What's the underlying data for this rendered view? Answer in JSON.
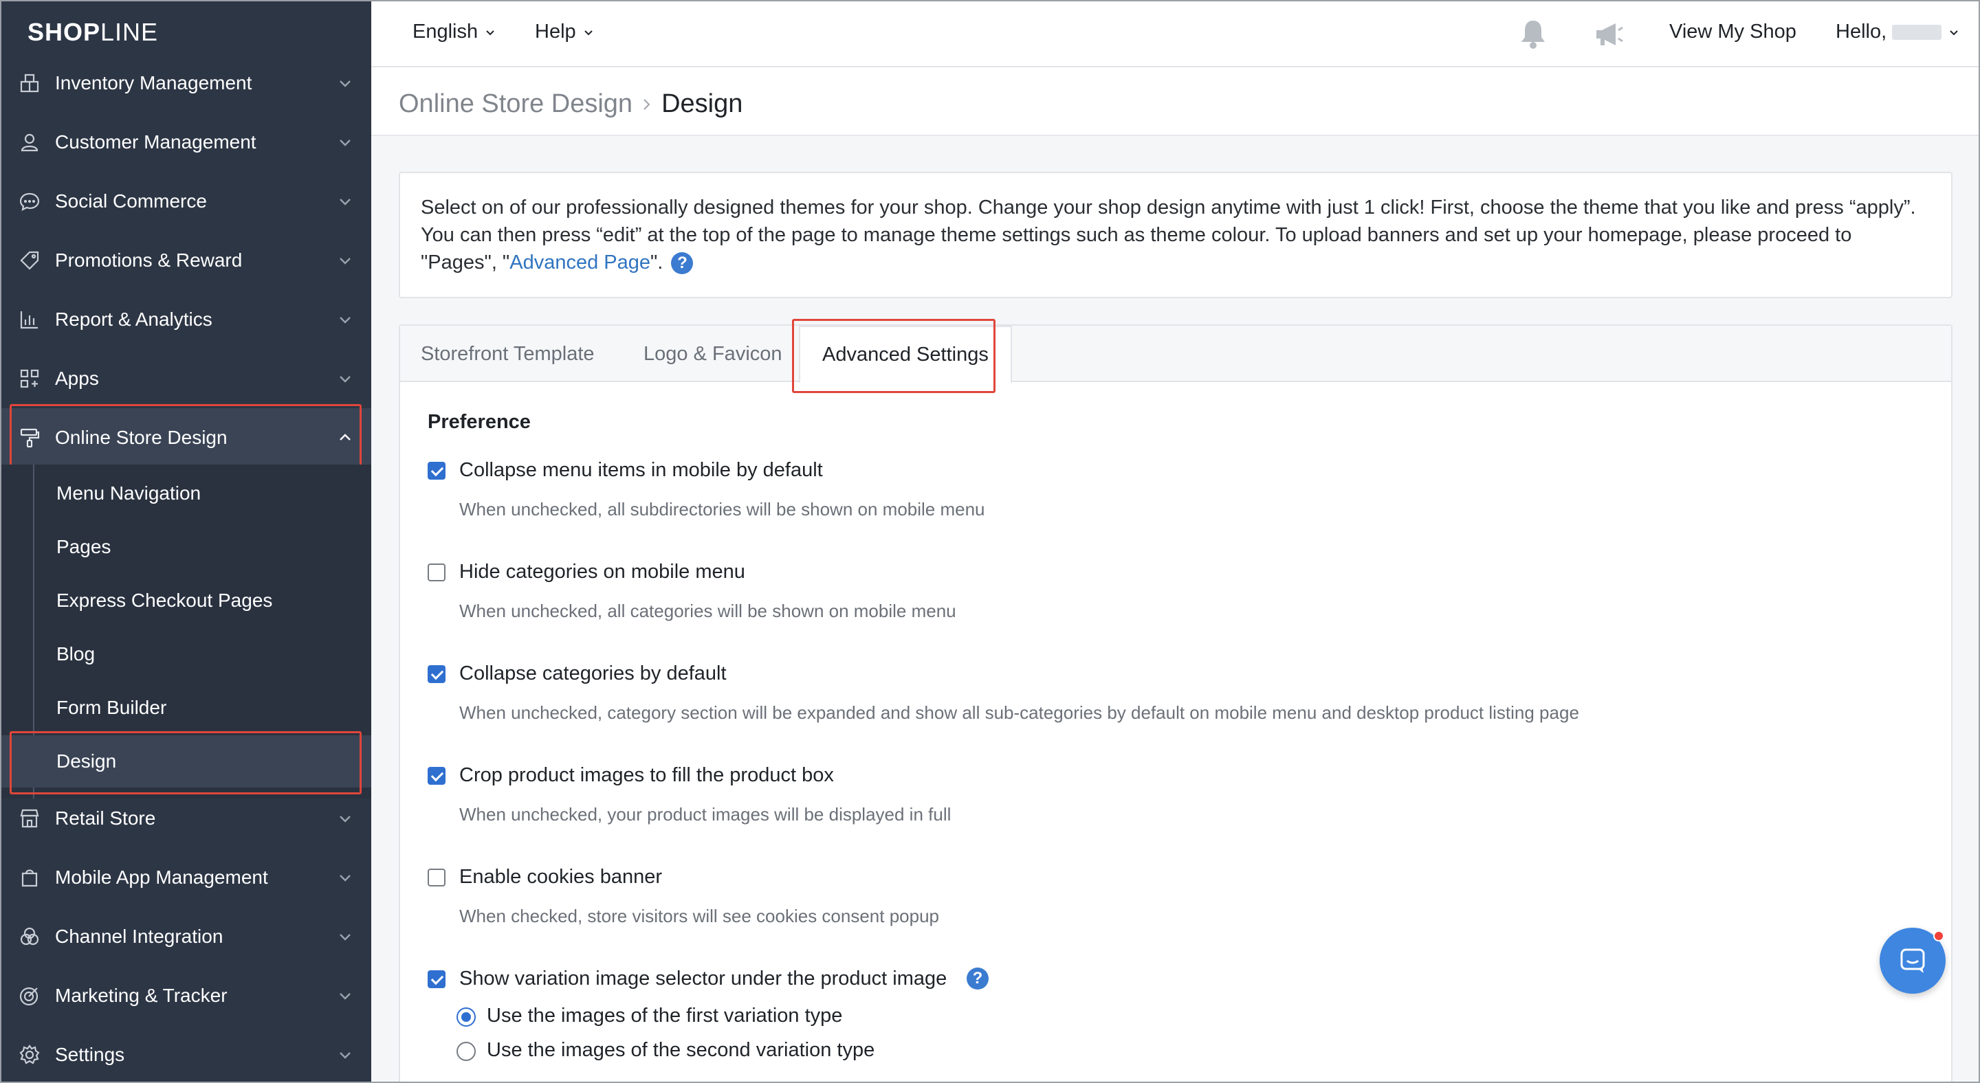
{
  "brand": {
    "logo_a": "SHOP",
    "logo_b": "LINE"
  },
  "sidebar": {
    "items": [
      {
        "label": "Inventory Management",
        "icon": "inventory-icon"
      },
      {
        "label": "Customer Management",
        "icon": "person-icon"
      },
      {
        "label": "Social Commerce",
        "icon": "chat-bubble-icon"
      },
      {
        "label": "Promotions & Reward",
        "icon": "tag-icon"
      },
      {
        "label": "Report & Analytics",
        "icon": "bar-chart-icon"
      },
      {
        "label": "Apps",
        "icon": "apps-grid-icon"
      },
      {
        "label": "Online Store Design",
        "icon": "paint-roller-icon",
        "expanded": true
      },
      {
        "label": "Retail Store",
        "icon": "store-icon"
      },
      {
        "label": "Mobile App Management",
        "icon": "shopping-bag-icon"
      },
      {
        "label": "Channel Integration",
        "icon": "channels-icon"
      },
      {
        "label": "Marketing & Tracker",
        "icon": "target-icon"
      },
      {
        "label": "Settings",
        "icon": "gear-icon"
      }
    ],
    "sub_items": [
      {
        "label": "Menu Navigation"
      },
      {
        "label": "Pages"
      },
      {
        "label": "Express Checkout Pages"
      },
      {
        "label": "Blog"
      },
      {
        "label": "Form Builder"
      },
      {
        "label": "Design",
        "active": true
      }
    ]
  },
  "topbar": {
    "language": "English",
    "help": "Help",
    "view_shop": "View My Shop",
    "greeting": "Hello,"
  },
  "breadcrumb": {
    "parent": "Online Store Design",
    "current": "Design"
  },
  "info": {
    "text_1": "Select on of our professionally designed themes for your shop. Change your shop design anytime with just 1 click! First, choose the theme that you like and press “apply”. You can then press “edit” at the top of the page to manage theme settings such as theme colour. To upload banners and set up your homepage, please proceed to \"Pages\", \"",
    "link": "Advanced Page",
    "text_2": "\"."
  },
  "tabs": [
    {
      "label": "Storefront Template"
    },
    {
      "label": "Logo & Favicon"
    },
    {
      "label": "Advanced Settings",
      "active": true
    }
  ],
  "preference": {
    "title": "Preference",
    "options": [
      {
        "label": "Collapse menu items in mobile by default",
        "desc": "When unchecked, all subdirectories will be shown on mobile menu",
        "checked": true
      },
      {
        "label": "Hide categories on mobile menu",
        "desc": "When unchecked, all categories will be shown on mobile menu",
        "checked": false
      },
      {
        "label": "Collapse categories by default",
        "desc": "When unchecked, category section will be expanded and show all sub-categories by default on mobile menu and desktop product listing page",
        "checked": true
      },
      {
        "label": "Crop product images to fill the product box",
        "desc": "When unchecked, your product images will be displayed in full",
        "checked": true
      },
      {
        "label": "Enable cookies banner",
        "desc": "When checked, store visitors will see cookies consent popup",
        "checked": false
      },
      {
        "label": "Show variation image selector under the product image",
        "desc": "",
        "checked": true
      }
    ],
    "radios": [
      {
        "label": "Use the images of the first variation type",
        "checked": true
      },
      {
        "label": "Use the images of the second variation type",
        "checked": false
      }
    ]
  },
  "colors": {
    "sidebar_bg": "#2d3645",
    "accent": "#2f6fd0",
    "highlight": "#e0463a",
    "link": "#2f74c0"
  }
}
